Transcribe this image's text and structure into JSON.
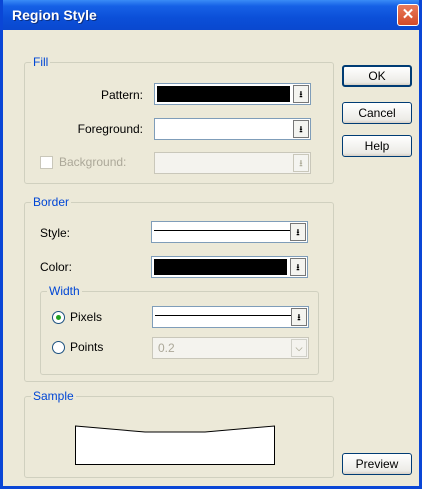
{
  "window": {
    "title": "Region Style",
    "close_glyph": "✕"
  },
  "fill": {
    "title": "Fill",
    "pattern_label": "Pattern:",
    "foreground_label": "Foreground:",
    "background_label": "Background:",
    "pattern_color": "#000000",
    "foreground_color": "#ffffff"
  },
  "border": {
    "title": "Border",
    "style_label": "Style:",
    "color_label": "Color:",
    "color_value": "#000000",
    "width": {
      "title": "Width",
      "pixels_label": "Pixels",
      "points_label": "Points",
      "points_value": "0.2",
      "selected": "pixels"
    }
  },
  "sample": {
    "title": "Sample"
  },
  "buttons": {
    "ok": "OK",
    "cancel": "Cancel",
    "help": "Help",
    "preview": "Preview"
  },
  "icons": {
    "dropdown": "dropdown-arrow-icon",
    "close": "close-icon"
  },
  "colors": {
    "group_title": "#0046d5",
    "titlebar": "#0a48cf",
    "dialog_bg": "#ece9d8"
  }
}
